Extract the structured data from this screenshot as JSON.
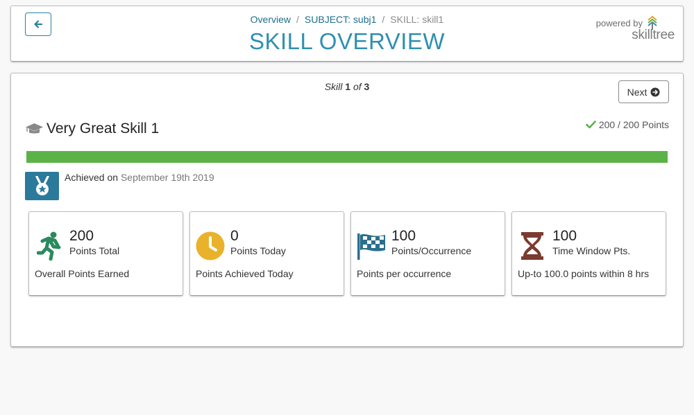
{
  "header": {
    "breadcrumb": [
      {
        "label": "Overview",
        "link": true
      },
      {
        "label": "SUBJECT: subj1",
        "link": true
      },
      {
        "label": "SKILL: skill1",
        "link": false
      }
    ],
    "title": "SKILL OVERVIEW",
    "powered_by": "powered by",
    "logo_text": "skilltree"
  },
  "pager": {
    "prefix": "Skill",
    "current": "1",
    "of": "of",
    "total": "3"
  },
  "next_label": "Next",
  "skill": {
    "name": "Very Great Skill 1",
    "points_summary": "200 / 200 Points",
    "progress_fraction": 1.0
  },
  "achievement": {
    "label": "Achieved on",
    "date": "September 19th 2019"
  },
  "stats": [
    {
      "icon": "running-person-icon",
      "value": "200",
      "label": "Points Total",
      "desc": "Overall Points Earned",
      "color": "#2a8a5c"
    },
    {
      "icon": "clock-icon",
      "value": "0",
      "label": "Points Today",
      "desc": "Points Achieved Today",
      "color": "#e9b22a"
    },
    {
      "icon": "checkered-flag-icon",
      "value": "100",
      "label": "Points/Occurrence",
      "desc": "Points per occurrence",
      "color": "#2b6f8e"
    },
    {
      "icon": "hourglass-icon",
      "value": "100",
      "label": "Time Window Pts.",
      "desc": "Up-to 100.0 points within 8 hrs",
      "color": "#7a3b30"
    }
  ],
  "colors": {
    "accent": "#2f8fb0",
    "progress": "#5cb247",
    "badge": "#2b7a9b"
  }
}
